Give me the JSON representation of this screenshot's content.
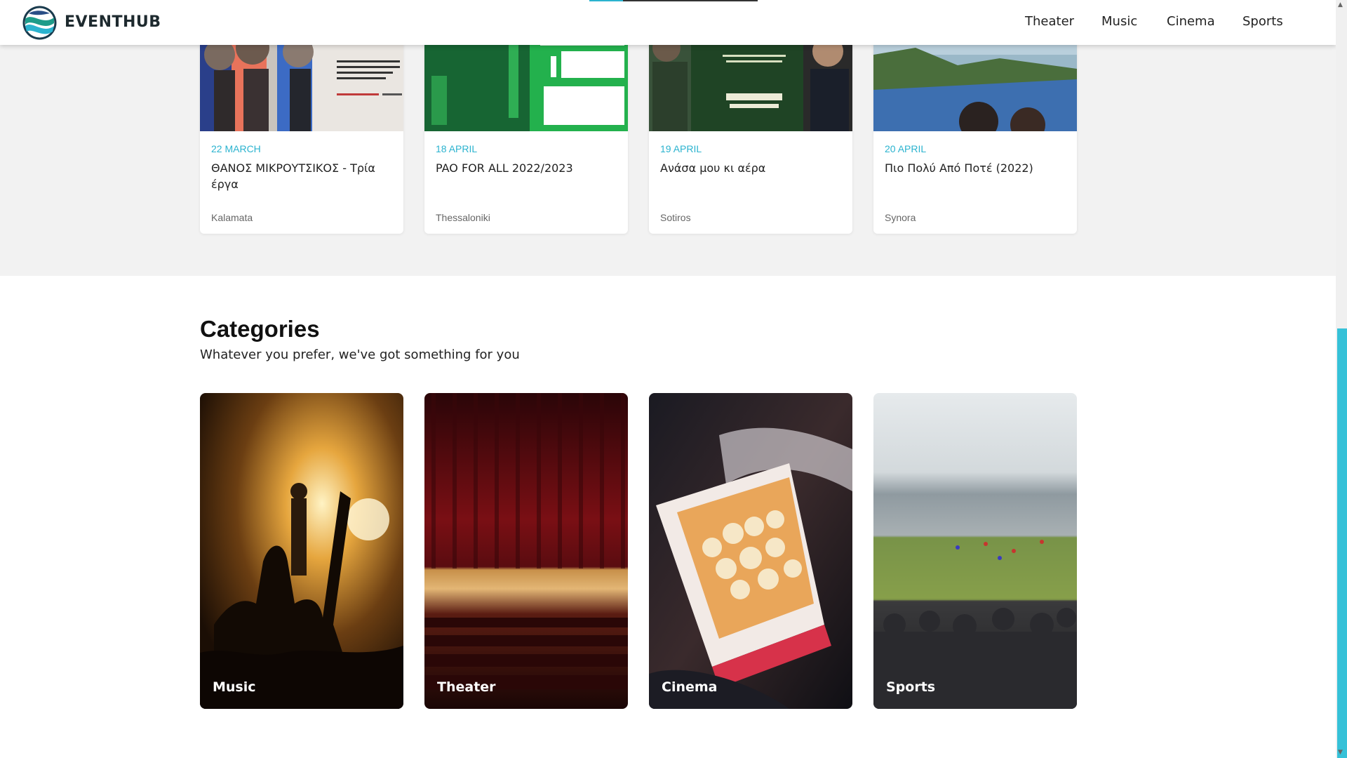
{
  "header": {
    "logo_text": "EVENTHUB",
    "nav": [
      "Theater",
      "Music",
      "Cinema",
      "Sports"
    ]
  },
  "events": [
    {
      "date": "22 MARCH",
      "title": "ΘΑΝΟΣ ΜΙΚΡΟΥΤΣΙΚΟΣ - Τρία έργα",
      "city": "Kalamata"
    },
    {
      "date": "18 APRIL",
      "title": "PAO FOR ALL 2022/2023",
      "city": "Thessaloniki"
    },
    {
      "date": "19 APRIL",
      "title": "Ανάσα μου κι αέρα",
      "city": "Sotiros"
    },
    {
      "date": "20 APRIL",
      "title": "Πιο Πολύ Από Ποτέ (2022)",
      "city": "Synora"
    }
  ],
  "categories": {
    "title": "Categories",
    "subtitle": "Whatever you prefer, we've got something for you",
    "items": [
      "Music",
      "Theater",
      "Cinema",
      "Sports"
    ]
  },
  "colors": {
    "accent": "#2bb3cf",
    "scroll_thumb": "#36c1d8",
    "band": "#f2f2f2"
  }
}
